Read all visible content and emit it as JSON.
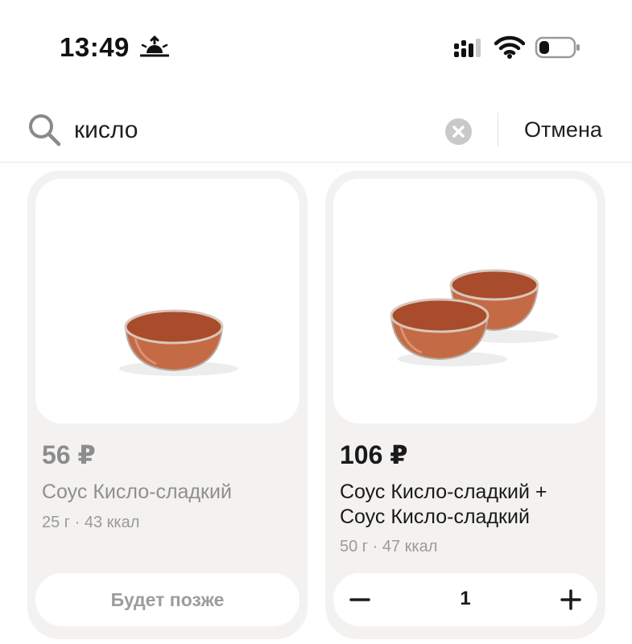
{
  "status_bar": {
    "time": "13:49",
    "icons": [
      "sunrise-icon",
      "cellular-signal-icon",
      "wifi-icon",
      "battery-icon"
    ]
  },
  "search": {
    "value": "кисло",
    "cancel_label": "Отмена",
    "icons": [
      "search-icon",
      "clear-icon"
    ]
  },
  "products": [
    {
      "price": "56 ₽",
      "title": "Соус Кисло-сладкий",
      "meta": "25 г · 43 ккал",
      "status_button": "Будет позже",
      "available": false,
      "image": "single-sauce-bowl"
    },
    {
      "price": "106 ₽",
      "title": "Соус Кисло-сладкий + Соус Кисло-сладкий",
      "meta": "50 г · 47 ккал",
      "quantity": "1",
      "available": true,
      "image": "two-sauce-bowls"
    }
  ],
  "colors": {
    "card_bg": "#f3f2f0",
    "sauce": "#c46a45",
    "muted_text": "#8f8f8f"
  }
}
